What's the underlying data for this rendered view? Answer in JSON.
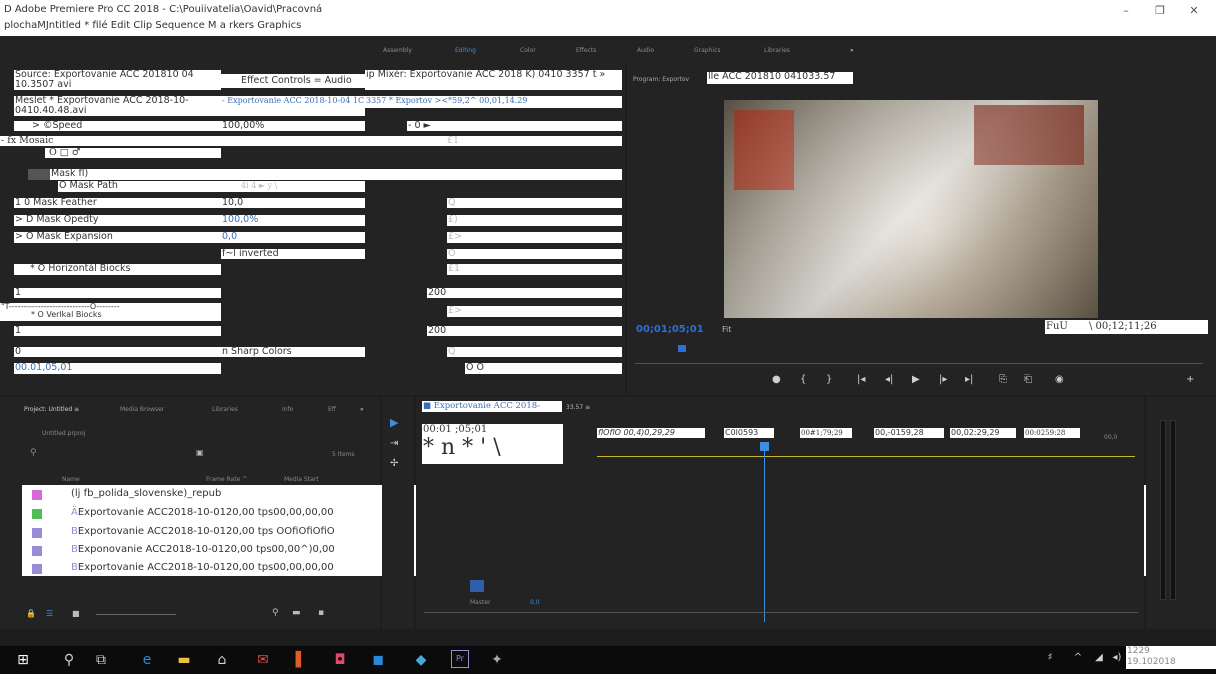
{
  "window": {
    "title_line1": "D Adobe Premiere Pro CC 2018 - C:\\Pouiivatelia\\Oavid\\Pracovná",
    "title_line2": "plochaMJntitled * filé Edit Clip Sequence M a rkers Graphics",
    "minimize": "–",
    "restore": "❐",
    "close": "✕"
  },
  "workspaces": [
    "Assembly",
    "Editing",
    "Color",
    "Effects",
    "Audio",
    "Graphics",
    "Libraries",
    "»"
  ],
  "active_workspace": "Editing",
  "effect_controls": {
    "source_tab": "Source: Exportovanie ACC 201810 04 10.3507 avi",
    "effect_tab": "Effect Controls = Audio",
    "mixer_tab": "ip Mixér: Exportovanie ACC 2018 K) 0410 3357 t »",
    "master_label": "Meslet * Exportovanie ACC 2018-10-0410.40.48.avi",
    "clip_label": "- Exportovanie ACC 2018-10-04 1C",
    "clip_tail": "3357 * Exportov ><*59,2^ 00,01,14.29",
    "speed_label": "> ©Speed",
    "speed_value": "100,00%",
    "speed_kf": "- 0 ►",
    "mosaic_label": "- fx Mosaic",
    "mosaic_kf": "£1",
    "shape_icons": "O □ ♂",
    "mask_label": "Mask fl)",
    "mask_path_label": "O Mask Path",
    "mask_path_kf": "4i 4 ► y \\",
    "feather_label": "1 0 Mask Feather",
    "feather_value": "10,0",
    "feather_kf": "Q",
    "opacity_label": "> D Mask Opedty",
    "opacity_value": "100,0%",
    "opacity_kf": "£)",
    "expansion_label": "> O Mask Expansion",
    "expansion_value": "0,0",
    "expansion_kf": "£>",
    "inverted_label": "f~l inverted",
    "inverted_kf": "O",
    "hblocks_label": "* O Horizontál Biocks",
    "hblocks_kf": "£1",
    "hblocks_min": "1",
    "hblocks_max": "200",
    "vblocks_slider": "\"T----------------------------O--------",
    "vblocks_label": "* O Verlkal Biocks",
    "vblocks_kf": "£>",
    "vblocks_min": "1",
    "vblocks_max": "200",
    "sharp_left": "0",
    "sharp_label": "n Sharp Colors",
    "sharp_kf": "Q",
    "timecode": "00.01,05,01",
    "footer_icons": "O O"
  },
  "program": {
    "label": "Program: Exportov",
    "title_suffix": "lle ACC 201810 041033.57",
    "timecode": "00;01;05;01",
    "fit": "Fit",
    "duration_prefix": "FuU",
    "duration": "\\ 00;12;11;26",
    "controls": [
      "●",
      "{",
      "}",
      "|◂",
      "◂|",
      "▶",
      "|▸",
      "▸|",
      "⎘",
      "⎗",
      "◉",
      "+"
    ]
  },
  "project": {
    "tabs": [
      "Project: Untitled ≡",
      "Media Browser",
      "Libraries",
      "Info",
      "Eff",
      "»"
    ],
    "file": "Untitled.prproj",
    "items_count": "5 Items",
    "col_name": "Name",
    "col_rate": "Frame Rate ^",
    "col_start": "Media Start",
    "files": [
      {
        "color": "#d86ad8",
        "first": "",
        "text": "(lj fb_polida_slovenske)_repub"
      },
      {
        "color": "#4fbf55",
        "first": "Ä",
        "text": "Exportovanie ACC2018-10-0120,00 tps00,00,00,00"
      },
      {
        "color": "#9a8bd6",
        "first": "B",
        "text": "Exportovanie ACC2018-10-0120,00 tps OOfiOfiOfiO"
      },
      {
        "color": "#9a8bd6",
        "first": "B",
        "text": "Exponovanie ACC2018-10-0120,00 tps00,00^)0,00"
      },
      {
        "color": "#9a8bd6",
        "first": "B",
        "text": "Exportovanie ACC2018-10-0120,00 tps00,00,00,00"
      }
    ]
  },
  "timeline": {
    "seq_tab": "■ Exportovanie ACC 2018-",
    "seq_tail": "33.57 ≡",
    "timecode": "00:01 ;05;01",
    "tools_glyph": "* n * ' \\",
    "ruler": [
      "flOflO 00,4)0,29,29",
      "C0l0593",
      "00#1;79;29",
      "00,-0159,28",
      "00,02:29,29",
      "00:0259:28",
      "00,0"
    ],
    "track_label": "Master",
    "track_val": "0,0"
  },
  "taskbar": {
    "time": "1229",
    "date": "19.102018",
    "icons": [
      "windows-icon",
      "search-icon",
      "taskview-icon",
      "edge-icon",
      "explorer-icon",
      "store-icon",
      "mail-icon",
      "office-icon",
      "shield-icon",
      "outlook-icon",
      "app-icon",
      "premiere-icon",
      "app2-icon"
    ]
  }
}
